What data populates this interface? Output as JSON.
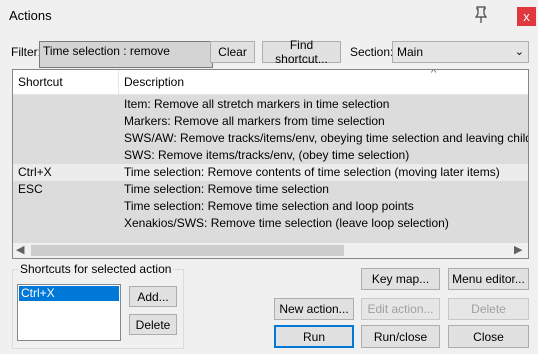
{
  "window": {
    "title": "Actions",
    "close_label": "x"
  },
  "filter": {
    "label": "Filter:",
    "value": "Time selection : remove"
  },
  "toolbar": {
    "clear_label": "Clear",
    "find_shortcut_label": "Find shortcut...",
    "section_label": "Section:",
    "section_value": "Main"
  },
  "table": {
    "headers": [
      "Shortcut",
      "Description"
    ],
    "rows": [
      {
        "shortcut": "",
        "description": "Item: Remove all stretch markers in time selection"
      },
      {
        "shortcut": "",
        "description": "Markers: Remove all markers from time selection"
      },
      {
        "shortcut": "",
        "description": "SWS/AW: Remove tracks/items/env, obeying time selection and leaving children"
      },
      {
        "shortcut": "",
        "description": "SWS: Remove items/tracks/env, (obey time selection)"
      },
      {
        "shortcut": "Ctrl+X",
        "description": "Time selection: Remove contents of time selection (moving later items)"
      },
      {
        "shortcut": "ESC",
        "description": "Time selection: Remove time selection"
      },
      {
        "shortcut": "",
        "description": "Time selection: Remove time selection and loop points"
      },
      {
        "shortcut": "",
        "description": "Xenakios/SWS: Remove time selection (leave loop selection)"
      }
    ],
    "sort_indicator": "^"
  },
  "shortcuts_group": {
    "title": "Shortcuts for selected action",
    "items": [
      "Ctrl+X"
    ],
    "add_label": "Add...",
    "delete_label": "Delete"
  },
  "buttons": {
    "key_map": "Key map...",
    "menu_editor": "Menu editor...",
    "new_action": "New action...",
    "edit_action": "Edit action...",
    "delete": "Delete",
    "run": "Run",
    "run_close": "Run/close",
    "close": "Close"
  }
}
